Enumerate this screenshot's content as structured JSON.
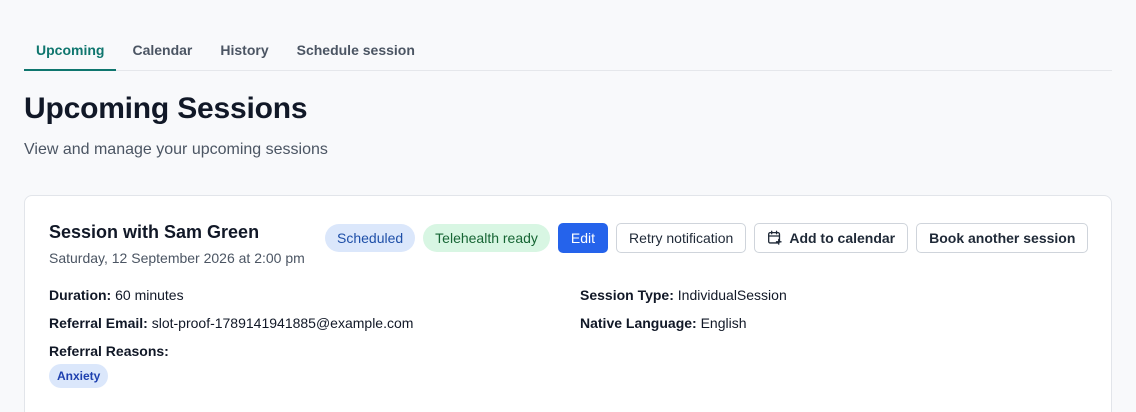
{
  "tabs": [
    {
      "label": "Upcoming",
      "active": true
    },
    {
      "label": "Calendar",
      "active": false
    },
    {
      "label": "History",
      "active": false
    },
    {
      "label": "Schedule session",
      "active": false
    }
  ],
  "page": {
    "title": "Upcoming Sessions",
    "subtitle": "View and manage your upcoming sessions"
  },
  "session": {
    "title": "Session with Sam Green",
    "datetime": "Saturday, 12 September 2026 at 2:00 pm",
    "status_badge": "Scheduled",
    "telehealth_badge": "Telehealth ready",
    "edit_label": "Edit",
    "retry_label": "Retry notification",
    "add_calendar_label": "Add to calendar",
    "book_another_label": "Book another session",
    "duration_label": "Duration:",
    "duration_value": "60 minutes",
    "referral_email_label": "Referral Email:",
    "referral_email_value": "slot-proof-1789141941885@example.com",
    "referral_reasons_label": "Referral Reasons:",
    "referral_reasons": [
      "Anxiety"
    ],
    "session_type_label": "Session Type:",
    "session_type_value": "IndividualSession",
    "native_language_label": "Native Language:",
    "native_language_value": "English"
  },
  "icons": {
    "add_calendar": "calendar-plus-icon"
  },
  "colors": {
    "accent_tab": "#0f766e",
    "primary_button": "#2563eb",
    "scheduled_badge_bg": "#dbe7fb",
    "telehealth_badge_bg": "#d8f6e3"
  }
}
